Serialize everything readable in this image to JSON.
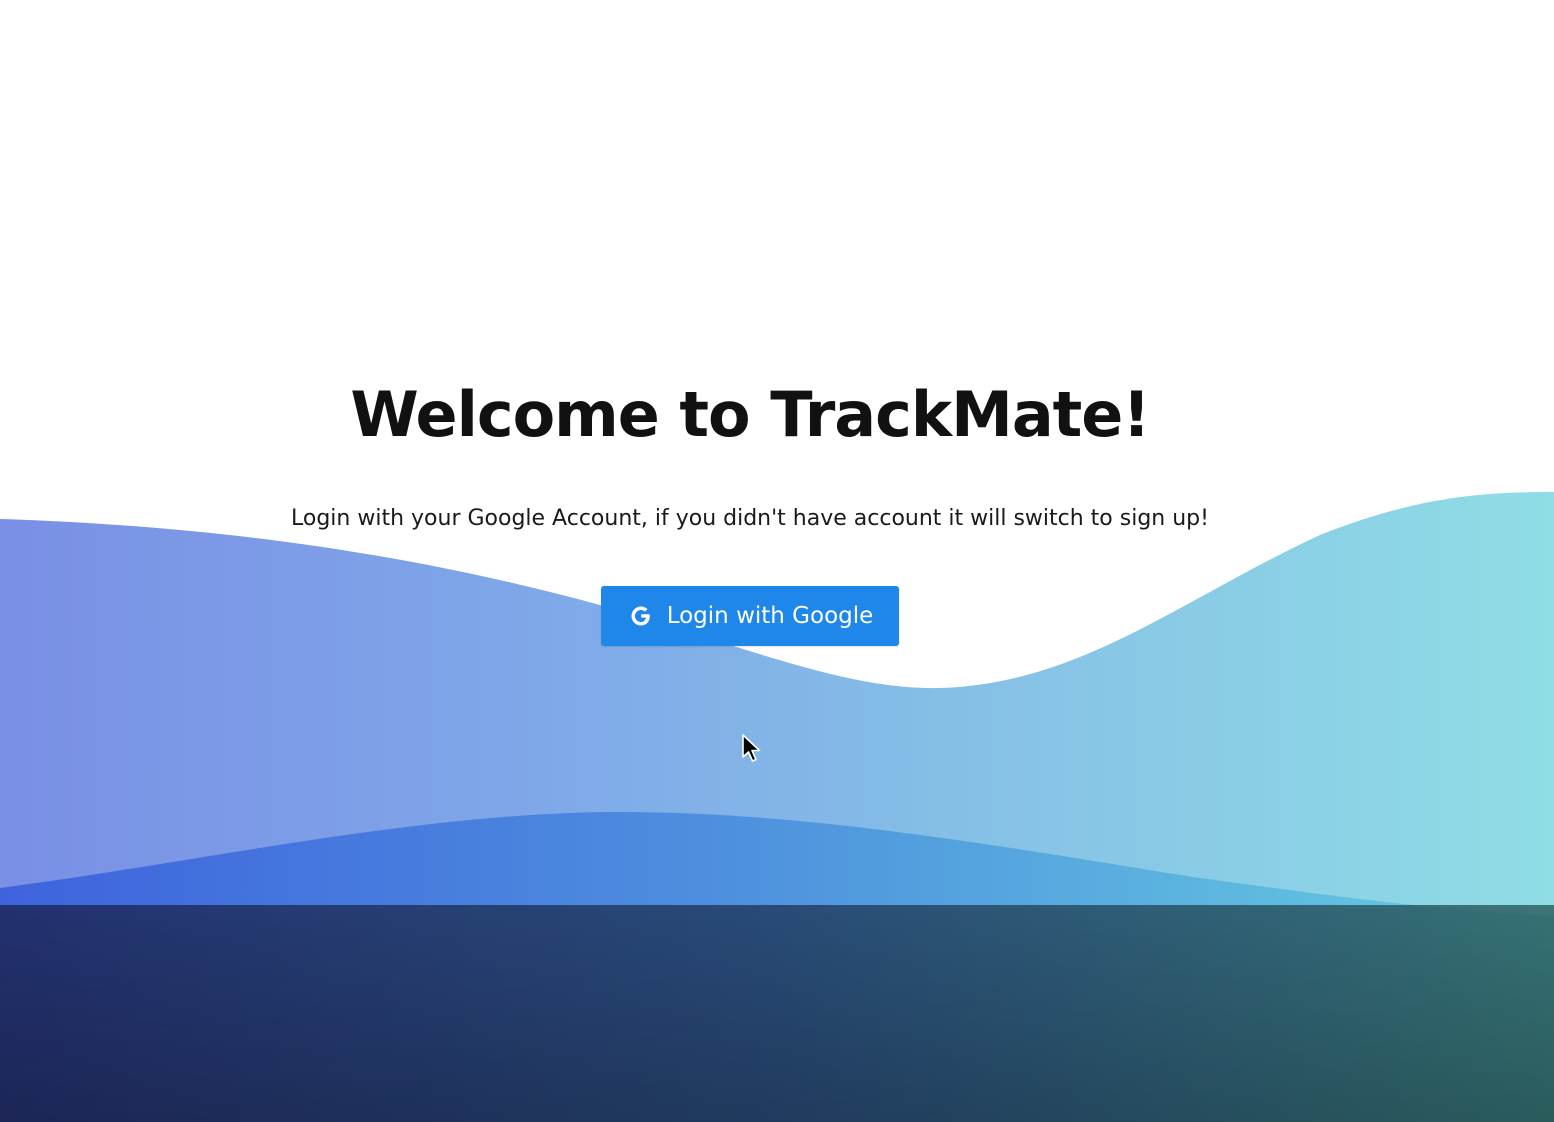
{
  "page": {
    "title": "Welcome to TrackMate!",
    "subtitle": "Login with your Google Account, if you didn't have account it will switch to sign up!"
  },
  "login_button": {
    "label": "Login with Google",
    "icon": "google-g-icon"
  },
  "colors": {
    "button_bg": "#1f86ea",
    "wave_light_left": "#7b8fe6",
    "wave_light_right": "#8fdce5",
    "wave_dark_left": "#3f63dd",
    "wave_dark_right": "#5ec6e0",
    "bottom_left": "#1c2454",
    "bottom_right": "#2a5a5a"
  }
}
